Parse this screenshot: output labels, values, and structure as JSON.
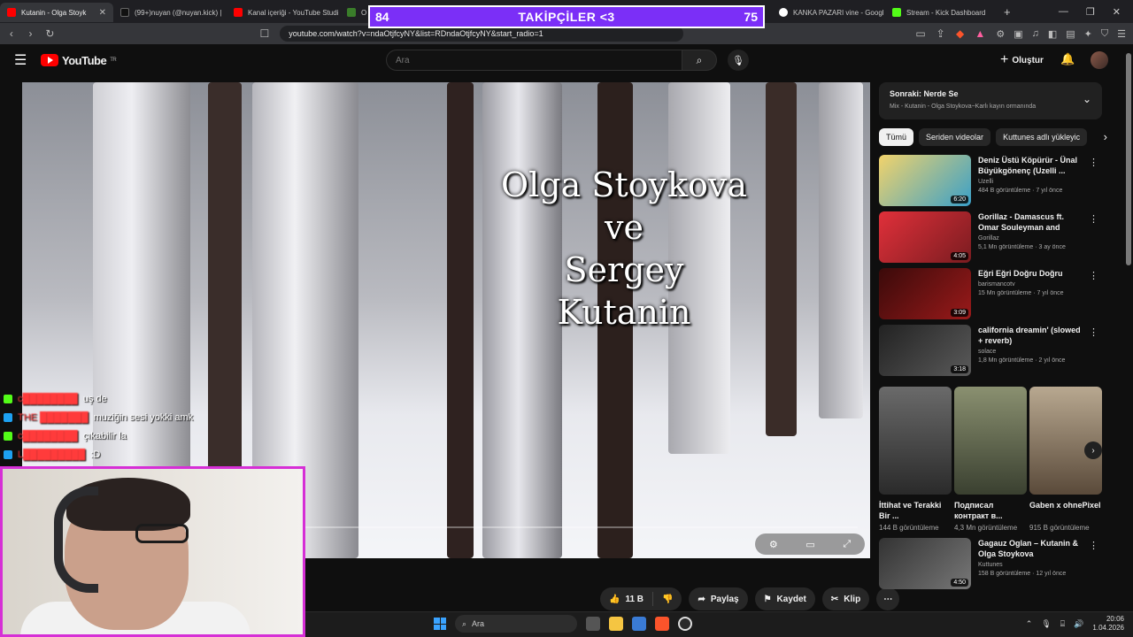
{
  "followers_bar": {
    "left_count": "84",
    "title": "TAKİPÇİLER <3",
    "right_count": "75"
  },
  "tabs": [
    {
      "title": "Kutanin - Olga Stoyk",
      "color": "#ff0000",
      "active": true
    },
    {
      "title": "(99+)nuyan (@nuyan.kick) |",
      "color": "#111111",
      "active": false
    },
    {
      "title": "Kanal içeriği - YouTube Studi",
      "color": "#ff0000",
      "active": false
    },
    {
      "title": "Ol",
      "color": "#3a7d2a",
      "active": false
    },
    {
      "title": "m",
      "color": "#6f6f6f",
      "active": false
    },
    {
      "title": "KANKA PAZARI vine - Googl",
      "color": "#ffffff",
      "active": false
    },
    {
      "title": "Stream - Kick Dashboard",
      "color": "#53fc18",
      "active": false
    }
  ],
  "address_bar": {
    "url": "youtube.com/watch?v=ndaOtjfcyNY&list=RDndaOtjfcyNY&start_radio=1"
  },
  "youtube": {
    "logo_text": "YouTube",
    "region": "TR",
    "search_placeholder": "Ara",
    "create_label": "Oluştur"
  },
  "video": {
    "title_lines": [
      "Olga Stoykova",
      "ve",
      "Sergey Kutanin"
    ]
  },
  "chat": [
    {
      "user": "c████████",
      "msg": "uş de",
      "badge": "#53fc18"
    },
    {
      "user": "THE ███████",
      "msg": "muziğin sesi yokki amk",
      "badge": "#1da1f2"
    },
    {
      "user": "c████████",
      "msg": "çıkabilir la",
      "badge": "#53fc18"
    },
    {
      "user": "L█████████",
      "msg": ":D",
      "badge": "#1da1f2"
    }
  ],
  "actions": {
    "likes": "11 B",
    "share": "Paylaş",
    "save": "Kaydet",
    "clip": "Klip"
  },
  "up_next": {
    "title": "Sonraki: Nerde Se",
    "subtitle": "Mix - Kutanin - Olga Stoykova~Karlı kayın ormanında"
  },
  "chips": [
    "Tümü",
    "Seriden videolar",
    "Kuttunes adlı yükleyic"
  ],
  "videos": [
    {
      "title": "Deniz Üstü Köpürür - Ünal Büyükgönenç (Uzelli ...",
      "channel": "Uzelli",
      "stats": "484 B görüntüleme · 7 yıl önce",
      "duration": "6:20",
      "thumb": "#3aa0c8"
    },
    {
      "title": "Gorillaz - Damascus ft. Omar Souleyman and Yasiin Bey ...",
      "channel": "Gorillaz",
      "stats": "5,1 Mn görüntüleme · 3 ay önce",
      "duration": "4:05",
      "thumb": "#e0303a"
    },
    {
      "title": "Eğri Eğri Doğru Doğru",
      "channel": "barismancotv",
      "stats": "15 Mn görüntüleme · 7 yıl önce",
      "duration": "3:09",
      "thumb": "#7a1010"
    },
    {
      "title": "california dreamin' (slowed + reverb)",
      "channel": "solace",
      "stats": "1,8 Mn görüntüleme · 2 yıl önce",
      "duration": "3:18",
      "thumb": "#3c3c3c"
    }
  ],
  "shorts": [
    {
      "title": "İttihat ve Terakki Bir ...",
      "views": "144 B görüntüleme",
      "thumb": "#4a4a4a"
    },
    {
      "title": "Подписал контракт в...",
      "views": "4,3 Mn görüntüleme",
      "thumb": "#5c6648"
    },
    {
      "title": "Gaben x ohnePixel",
      "views": "915 B görüntüleme",
      "thumb": "#8a7a6a"
    }
  ],
  "last_video": {
    "title": "Gagauz Oglan – Kutanin & Olga Stoykova",
    "channel": "Kuttunes",
    "stats": "158 B görüntüleme · 12 yıl önce",
    "duration": "4:50",
    "thumb": "#505050"
  },
  "taskbar": {
    "search_placeholder": "Ara",
    "time": "20:06",
    "date": "1.04.2026"
  }
}
